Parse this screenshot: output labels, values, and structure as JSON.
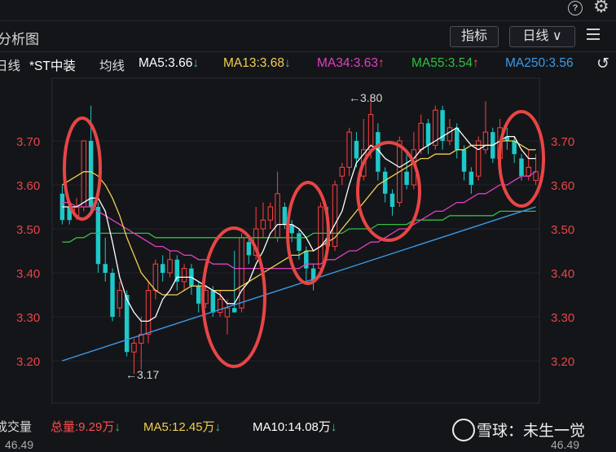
{
  "header": {
    "title": "分析图",
    "indicator_button": "指标",
    "period_button": "日线 ∨"
  },
  "ma_bar": {
    "type_label": "日线",
    "stock_name": "*ST中装",
    "avg_label": "均线",
    "ma5": "MA5:3.66",
    "ma13": "MA13:3.68",
    "ma34": "MA34:3.63",
    "ma55": "MA55:3.54",
    "ma250": "MA250:3.56"
  },
  "annotations": {
    "high": "←3.80",
    "low": "←3.17"
  },
  "volume_bar": {
    "label": "成交量",
    "total": "总量:9.29万",
    "ma5": "MA5:12.45万",
    "ma10": "MA10:14.08万"
  },
  "watermark": "雪球：未生一觉",
  "bottom": {
    "left_value": "46.49",
    "right_value": "46.49"
  },
  "colors": {
    "up": "#ff4040",
    "down": "#1dc9c9",
    "ma5": "#ffffff",
    "ma13": "#f0d050",
    "ma34": "#e040c0",
    "ma55": "#30c040",
    "ma250": "#3a9ae8",
    "circle": "#e84545"
  },
  "chart_data": {
    "type": "candlestick",
    "yticks": [
      3.7,
      3.6,
      3.5,
      3.4,
      3.3,
      3.2
    ],
    "ylim": [
      3.14,
      3.84
    ],
    "candles": [
      [
        3.58,
        3.52,
        3.6,
        3.51
      ],
      [
        3.55,
        3.52,
        3.56,
        3.51
      ],
      [
        3.53,
        3.55,
        3.57,
        3.52
      ],
      [
        3.55,
        3.7,
        3.7,
        3.54
      ],
      [
        3.7,
        3.55,
        3.78,
        3.53
      ],
      [
        3.55,
        3.42,
        3.56,
        3.4
      ],
      [
        3.42,
        3.4,
        3.48,
        3.38
      ],
      [
        3.4,
        3.3,
        3.41,
        3.29
      ],
      [
        3.32,
        3.36,
        3.38,
        3.3
      ],
      [
        3.35,
        3.22,
        3.36,
        3.21
      ],
      [
        3.22,
        3.24,
        3.25,
        3.17
      ],
      [
        3.24,
        3.26,
        3.3,
        3.18
      ],
      [
        3.26,
        3.36,
        3.38,
        3.24
      ],
      [
        3.36,
        3.42,
        3.43,
        3.34
      ],
      [
        3.42,
        3.4,
        3.44,
        3.38
      ],
      [
        3.4,
        3.43,
        3.45,
        3.39
      ],
      [
        3.43,
        3.38,
        3.44,
        3.36
      ],
      [
        3.38,
        3.41,
        3.42,
        3.36
      ],
      [
        3.41,
        3.37,
        3.42,
        3.35
      ],
      [
        3.37,
        3.33,
        3.38,
        3.31
      ],
      [
        3.33,
        3.36,
        3.37,
        3.32
      ],
      [
        3.36,
        3.31,
        3.37,
        3.3
      ],
      [
        3.31,
        3.34,
        3.36,
        3.3
      ],
      [
        3.3,
        3.32,
        3.34,
        3.26
      ],
      [
        3.32,
        3.31,
        3.45,
        3.31
      ],
      [
        3.32,
        3.48,
        3.49,
        3.31
      ],
      [
        3.47,
        3.44,
        3.48,
        3.42
      ],
      [
        3.44,
        3.5,
        3.55,
        3.43
      ],
      [
        3.5,
        3.52,
        3.56,
        3.48
      ],
      [
        3.52,
        3.55,
        3.56,
        3.5
      ],
      [
        3.48,
        3.58,
        3.63,
        3.47
      ],
      [
        3.55,
        3.51,
        3.56,
        3.5
      ],
      [
        3.51,
        3.49,
        3.52,
        3.47
      ],
      [
        3.49,
        3.45,
        3.5,
        3.43
      ],
      [
        3.45,
        3.41,
        3.46,
        3.38
      ],
      [
        3.41,
        3.38,
        3.42,
        3.36
      ],
      [
        3.41,
        3.55,
        3.56,
        3.4
      ],
      [
        3.48,
        3.46,
        3.55,
        3.45
      ],
      [
        3.46,
        3.6,
        3.61,
        3.45
      ],
      [
        3.62,
        3.64,
        3.65,
        3.6
      ],
      [
        3.64,
        3.72,
        3.73,
        3.62
      ],
      [
        3.7,
        3.66,
        3.72,
        3.64
      ],
      [
        3.62,
        3.68,
        3.75,
        3.61
      ],
      [
        3.68,
        3.76,
        3.8,
        3.66
      ],
      [
        3.72,
        3.63,
        3.74,
        3.61
      ],
      [
        3.63,
        3.58,
        3.64,
        3.56
      ],
      [
        3.58,
        3.55,
        3.59,
        3.53
      ],
      [
        3.56,
        3.7,
        3.71,
        3.55
      ],
      [
        3.63,
        3.6,
        3.68,
        3.59
      ],
      [
        3.6,
        3.68,
        3.72,
        3.59
      ],
      [
        3.68,
        3.74,
        3.76,
        3.67
      ],
      [
        3.74,
        3.69,
        3.75,
        3.67
      ],
      [
        3.69,
        3.77,
        3.78,
        3.68
      ],
      [
        3.77,
        3.7,
        3.78,
        3.68
      ],
      [
        3.7,
        3.73,
        3.75,
        3.69
      ],
      [
        3.73,
        3.68,
        3.74,
        3.66
      ],
      [
        3.68,
        3.63,
        3.69,
        3.61
      ],
      [
        3.63,
        3.6,
        3.64,
        3.58
      ],
      [
        3.62,
        3.7,
        3.71,
        3.61
      ],
      [
        3.68,
        3.72,
        3.79,
        3.67
      ],
      [
        3.72,
        3.66,
        3.73,
        3.65
      ],
      [
        3.66,
        3.73,
        3.75,
        3.65
      ],
      [
        3.71,
        3.7,
        3.73,
        3.68
      ],
      [
        3.7,
        3.67,
        3.71,
        3.65
      ],
      [
        3.66,
        3.62,
        3.67,
        3.61
      ],
      [
        3.62,
        3.64,
        3.68,
        3.61
      ],
      [
        3.61,
        3.63,
        3.67,
        3.6
      ]
    ],
    "ma5": [
      3.55,
      3.55,
      3.55,
      3.56,
      3.57,
      3.57,
      3.54,
      3.47,
      3.39,
      3.34,
      3.31,
      3.29,
      3.29,
      3.3,
      3.34,
      3.36,
      3.39,
      3.39,
      3.39,
      3.38,
      3.37,
      3.36,
      3.35,
      3.33,
      3.33,
      3.36,
      3.38,
      3.42,
      3.45,
      3.49,
      3.51,
      3.51,
      3.51,
      3.5,
      3.48,
      3.45,
      3.46,
      3.48,
      3.51,
      3.54,
      3.6,
      3.65,
      3.67,
      3.69,
      3.68,
      3.66,
      3.65,
      3.64,
      3.65,
      3.66,
      3.68,
      3.69,
      3.7,
      3.71,
      3.72,
      3.73,
      3.71,
      3.69,
      3.68,
      3.69,
      3.69,
      3.7,
      3.71,
      3.71,
      3.68,
      3.66,
      3.66
    ],
    "ma13": [
      3.6,
      3.61,
      3.62,
      3.63,
      3.63,
      3.62,
      3.6,
      3.57,
      3.53,
      3.48,
      3.44,
      3.4,
      3.38,
      3.36,
      3.35,
      3.35,
      3.35,
      3.36,
      3.37,
      3.37,
      3.37,
      3.36,
      3.36,
      3.36,
      3.36,
      3.37,
      3.38,
      3.39,
      3.4,
      3.41,
      3.42,
      3.43,
      3.44,
      3.44,
      3.45,
      3.45,
      3.46,
      3.47,
      3.48,
      3.5,
      3.52,
      3.54,
      3.56,
      3.58,
      3.6,
      3.61,
      3.62,
      3.63,
      3.64,
      3.65,
      3.66,
      3.66,
      3.67,
      3.67,
      3.67,
      3.68,
      3.68,
      3.69,
      3.69,
      3.69,
      3.69,
      3.7,
      3.7,
      3.7,
      3.69,
      3.68,
      3.68
    ],
    "ma34": [
      3.56,
      3.56,
      3.55,
      3.55,
      3.55,
      3.54,
      3.53,
      3.52,
      3.51,
      3.5,
      3.49,
      3.48,
      3.47,
      3.46,
      3.46,
      3.45,
      3.45,
      3.44,
      3.44,
      3.43,
      3.43,
      3.42,
      3.42,
      3.42,
      3.41,
      3.41,
      3.41,
      3.41,
      3.41,
      3.41,
      3.41,
      3.41,
      3.41,
      3.41,
      3.42,
      3.42,
      3.42,
      3.43,
      3.43,
      3.44,
      3.45,
      3.45,
      3.46,
      3.47,
      3.47,
      3.48,
      3.49,
      3.5,
      3.5,
      3.51,
      3.52,
      3.53,
      3.54,
      3.54,
      3.55,
      3.56,
      3.56,
      3.57,
      3.58,
      3.58,
      3.59,
      3.6,
      3.6,
      3.61,
      3.62,
      3.62,
      3.63
    ],
    "ma55": [
      3.47,
      3.47,
      3.48,
      3.48,
      3.49,
      3.49,
      3.49,
      3.49,
      3.49,
      3.49,
      3.49,
      3.49,
      3.49,
      3.48,
      3.48,
      3.48,
      3.48,
      3.48,
      3.48,
      3.48,
      3.48,
      3.48,
      3.48,
      3.48,
      3.48,
      3.48,
      3.48,
      3.48,
      3.48,
      3.48,
      3.48,
      3.48,
      3.48,
      3.48,
      3.48,
      3.49,
      3.49,
      3.49,
      3.49,
      3.49,
      3.5,
      3.5,
      3.5,
      3.5,
      3.51,
      3.51,
      3.51,
      3.51,
      3.51,
      3.52,
      3.52,
      3.52,
      3.52,
      3.52,
      3.53,
      3.53,
      3.53,
      3.53,
      3.53,
      3.53,
      3.53,
      3.54,
      3.54,
      3.54,
      3.54,
      3.54,
      3.54
    ],
    "ma250_start": 3.2,
    "ma250_end": 3.55
  }
}
